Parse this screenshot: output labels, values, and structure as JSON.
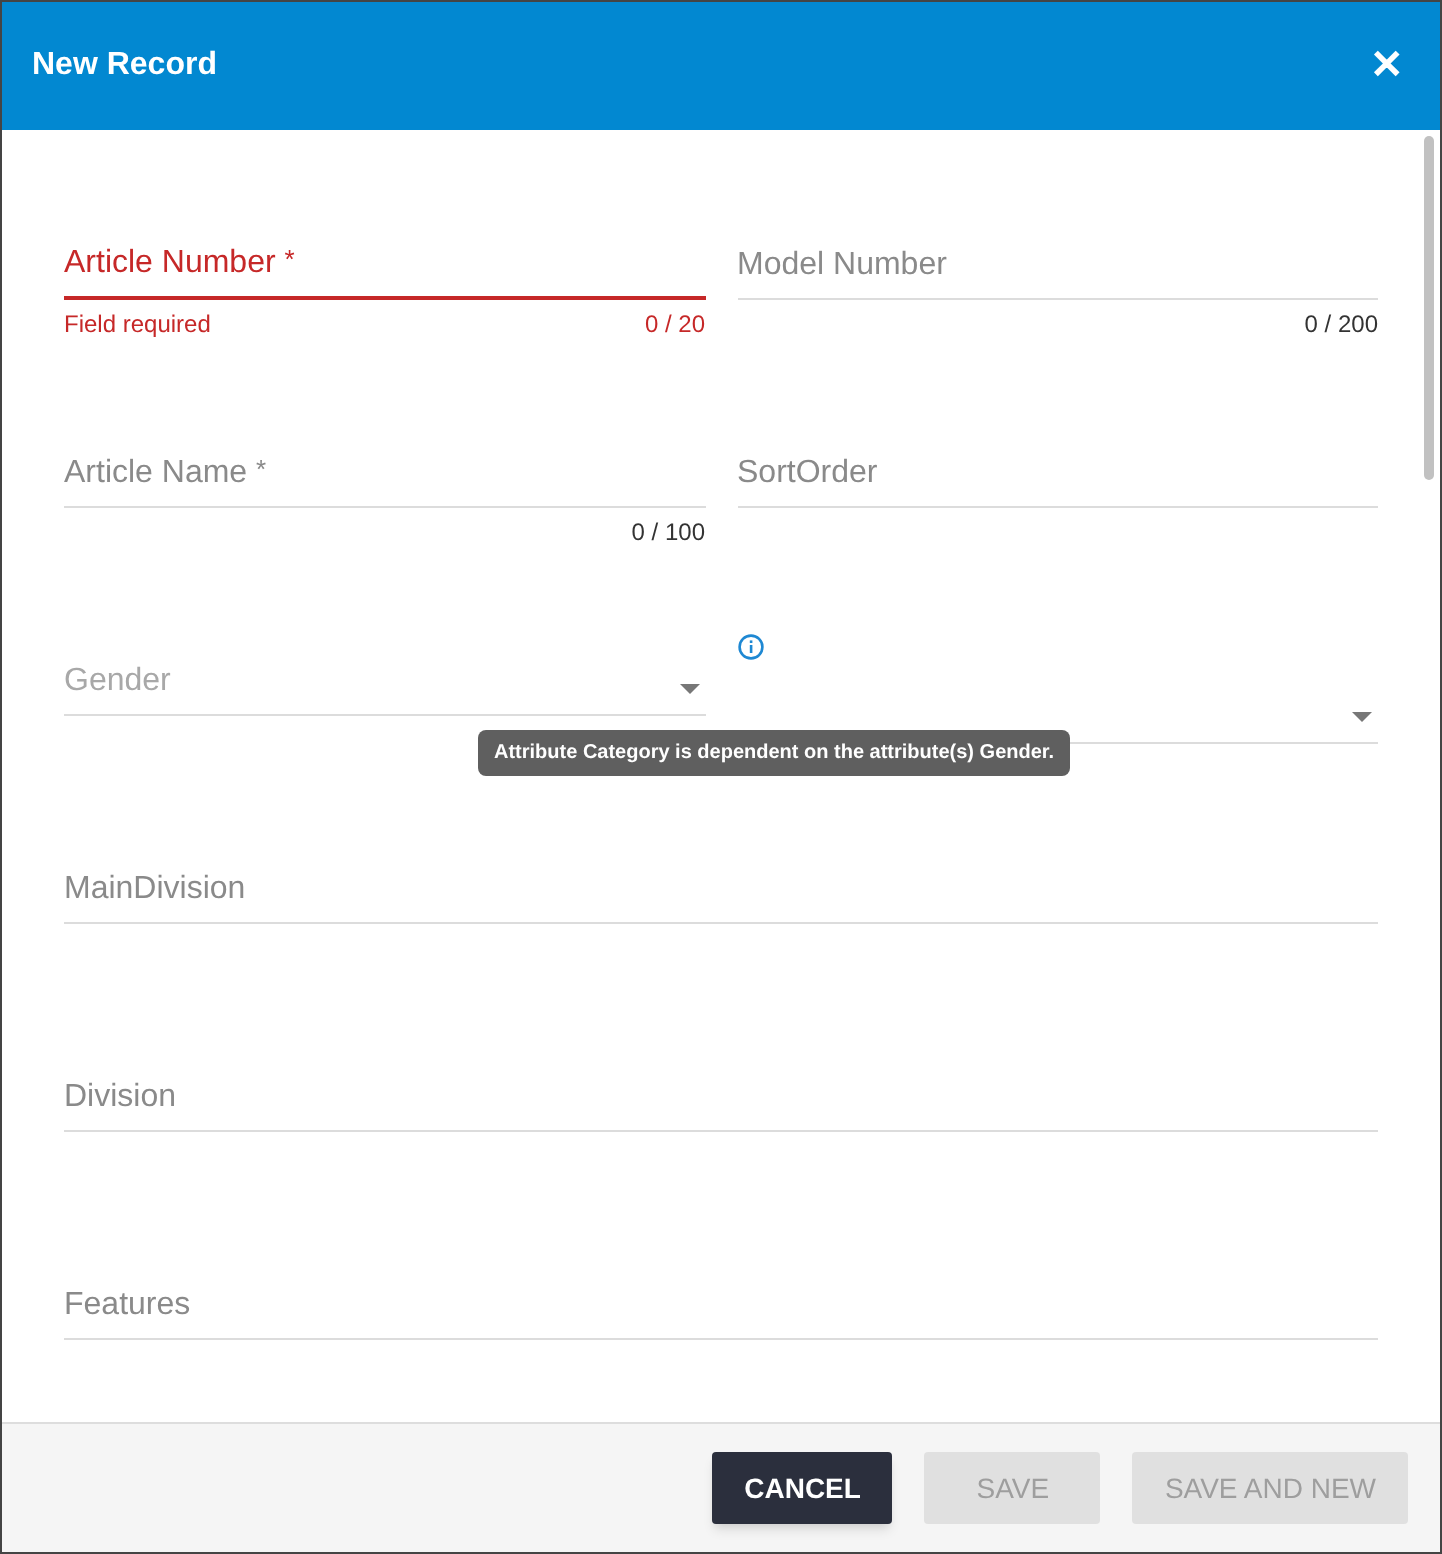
{
  "window": {
    "title": "New Record",
    "close": "✕"
  },
  "rows": [
    {
      "fields": [
        {
          "kind": "text",
          "label": "Article Number",
          "required_mark": "*",
          "error": "Field required",
          "counter": "0 / 20"
        },
        {
          "kind": "text",
          "label": "Model Number",
          "counter": "0 / 200"
        }
      ]
    },
    {
      "fields": [
        {
          "kind": "text",
          "label": "Article Name",
          "required_mark": "*",
          "counter": "0 / 100"
        },
        {
          "kind": "text",
          "label": "SortOrder"
        }
      ]
    },
    {
      "fields": [
        {
          "kind": "select",
          "label": "Gender"
        },
        {
          "kind": "select",
          "info": true
        }
      ]
    },
    {
      "fields": [
        {
          "kind": "text",
          "label": "MainDivision"
        }
      ]
    },
    {
      "fields": [
        {
          "kind": "text",
          "label": "Division"
        }
      ]
    },
    {
      "fields": [
        {
          "kind": "text",
          "label": "Features"
        }
      ]
    }
  ],
  "tooltip": {
    "text": "Attribute Category is dependent on the attribute(s) Gender."
  },
  "buttons": [
    {
      "label": "CANCEL",
      "disabled": false
    },
    {
      "label": "SAVE",
      "disabled": true
    },
    {
      "label": "SAVE AND NEW",
      "disabled": true
    }
  ]
}
